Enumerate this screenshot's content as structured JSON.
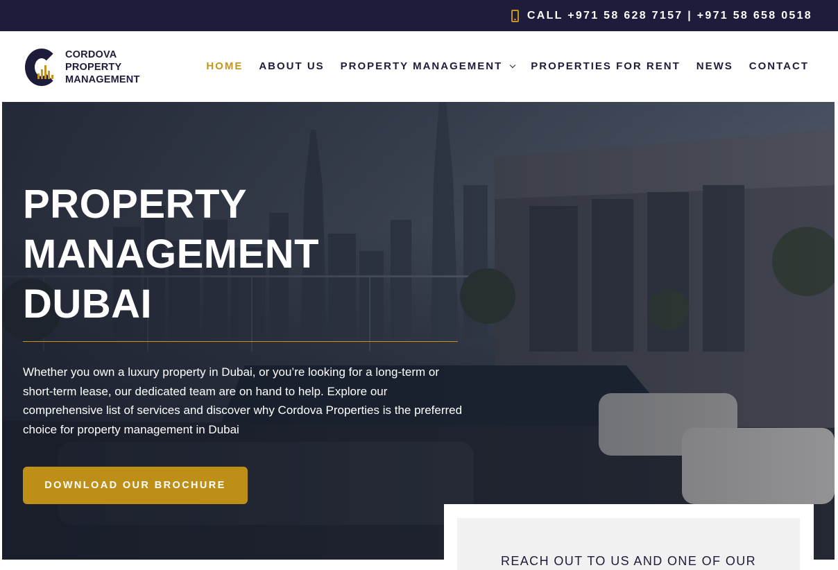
{
  "topbar": {
    "call_text": "CALL +971 58 628 7157 | +971 58 658 0518"
  },
  "logo": {
    "line1": "CORDOVA",
    "line2": "PROPERTY",
    "line3": "MANAGEMENT"
  },
  "nav": {
    "items": [
      {
        "label": "HOME",
        "active": true
      },
      {
        "label": "ABOUT US"
      },
      {
        "label": "PROPERTY MANAGEMENT",
        "has_dropdown": true
      },
      {
        "label": "PROPERTIES FOR RENT"
      },
      {
        "label": "NEWS"
      },
      {
        "label": "CONTACT"
      }
    ]
  },
  "hero": {
    "title_line1": "PROPERTY",
    "title_line2": "MANAGEMENT",
    "title_line3": "DUBAI",
    "description": "Whether you own a luxury property in Dubai, or you’re looking for a long-term or short-term lease, our dedicated team are on hand to help. Explore our comprehensive list of services and discover why Cordova Properties is the preferred choice for property management in Dubai",
    "button_label": "DOWNLOAD OUR BROCHURE"
  },
  "contact_card": {
    "heading": "REACH OUT TO US AND ONE OF OUR"
  },
  "colors": {
    "navy": "#1d1d3b",
    "gold": "#c6951a",
    "button_gold": "#bd8f17"
  },
  "icons": {
    "phone": "phone-icon",
    "dropdown": "chevron-down-icon"
  }
}
